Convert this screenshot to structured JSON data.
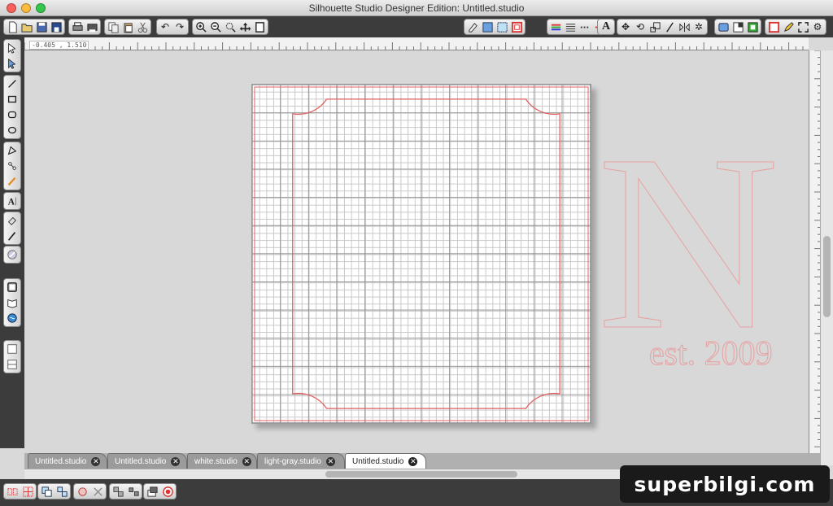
{
  "window": {
    "title": "Silhouette Studio Designer Edition: Untitled.studio"
  },
  "toolbar": {
    "groups": [
      [
        "new-icon",
        "open-icon",
        "save-icon",
        "save-library-icon"
      ],
      [
        "print-icon",
        "cut-print-icon"
      ],
      [
        "copy-icon",
        "paste-icon",
        "scissors-icon"
      ],
      [
        "undo-icon",
        "redo-icon"
      ],
      [
        "zoom-in-icon",
        "zoom-out-icon",
        "zoom-select-icon",
        "pan-icon",
        "fit-page-icon"
      ],
      [
        "page-setup-icon",
        "grid-icon",
        "registration-icon",
        "cut-style-icon"
      ],
      [
        "line-color-icon",
        "line-style-icon",
        "fill-icon",
        "cut-settings-icon"
      ],
      [
        "text-icon"
      ],
      [
        "move-icon",
        "rotate-icon",
        "scale-icon",
        "shear-icon",
        "mirror-icon",
        "trace-icon"
      ],
      [
        "library-icon",
        "store-icon",
        "send-icon"
      ],
      [
        "design-icon",
        "pen-icon",
        "fullscreen-icon",
        "settings-icon"
      ]
    ]
  },
  "ruler": {
    "coordinate": "-0.405 , 1.510"
  },
  "leftTools": {
    "groups": [
      [
        "select-icon",
        "point-edit-icon"
      ],
      [
        "line-tool-icon",
        "rectangle-tool-icon",
        "rounded-rect-tool-icon",
        "ellipse-tool-icon"
      ],
      [
        "polygon-tool-icon",
        "bezier-tool-icon",
        "freehand-tool-icon"
      ],
      [
        "text-tool-icon"
      ],
      [
        "eraser-tool-icon",
        "knife-tool-icon"
      ],
      [
        "brush-tool-icon"
      ],
      [
        "page-icon",
        "library-panel-icon",
        "online-store-icon"
      ],
      [
        "panel-top-icon",
        "panel-bottom-icon"
      ]
    ]
  },
  "canvas": {
    "watermark_letter": "N",
    "watermark_text": "est. 2009"
  },
  "tabs": [
    {
      "label": "Untitled.studio",
      "active": false
    },
    {
      "label": "Untitled.studio",
      "active": false
    },
    {
      "label": "white.studio",
      "active": false
    },
    {
      "label": "light-gray.studio",
      "active": false
    },
    {
      "label": "Untitled.studio",
      "active": true
    }
  ],
  "tab_close_glyph": "✕",
  "bottomTools": {
    "groups": [
      [
        "replicate-icon",
        "duplicate-icon"
      ],
      [
        "group-icon",
        "ungroup-icon"
      ],
      [
        "compound-icon",
        "release-icon"
      ],
      [
        "align-icon",
        "distribute-icon"
      ],
      [
        "layers-icon",
        "cut-icon"
      ]
    ]
  },
  "brand": {
    "text": "superbilgi.com"
  },
  "colors": {
    "cut_line": "#e06060",
    "watermark": "#e8a0a0",
    "toolbar_bg": "#3c3c3c"
  }
}
